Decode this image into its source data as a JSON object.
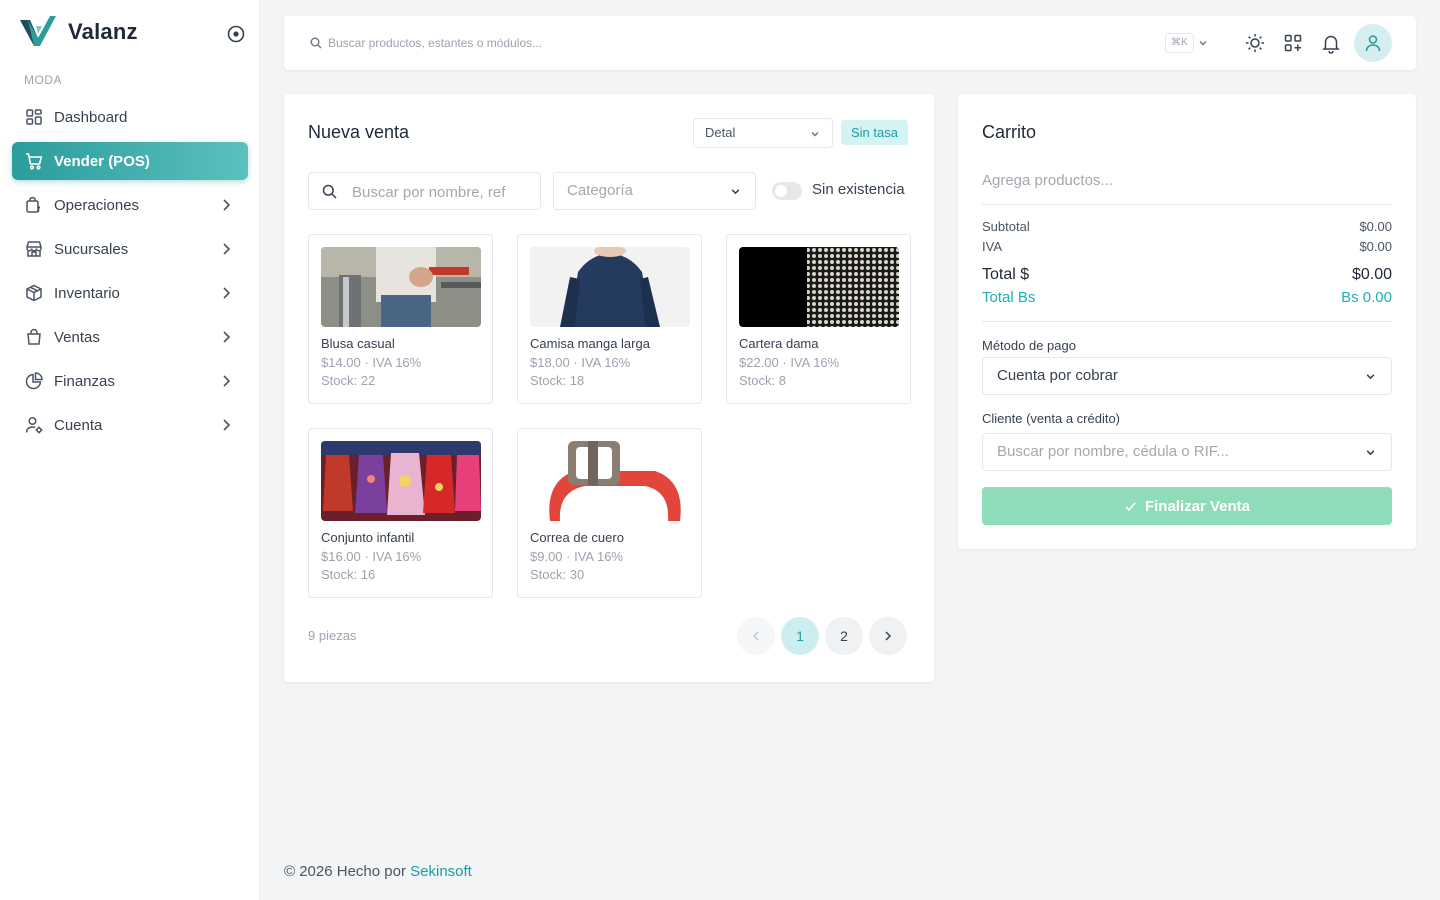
{
  "brand": {
    "name": "Valanz"
  },
  "sidebar": {
    "section": "MODA",
    "items": [
      {
        "label": "Dashboard",
        "icon": "dashboard-icon",
        "active": false,
        "has_children": false
      },
      {
        "label": "Vender (POS)",
        "icon": "cart-icon",
        "active": true,
        "has_children": false
      },
      {
        "label": "Operaciones",
        "icon": "operations-icon",
        "active": false,
        "has_children": true
      },
      {
        "label": "Sucursales",
        "icon": "store-icon",
        "active": false,
        "has_children": true
      },
      {
        "label": "Inventario",
        "icon": "box-icon",
        "active": false,
        "has_children": true
      },
      {
        "label": "Ventas",
        "icon": "shopping-bag-icon",
        "active": false,
        "has_children": true
      },
      {
        "label": "Finanzas",
        "icon": "pie-chart-icon",
        "active": false,
        "has_children": true
      },
      {
        "label": "Cuenta",
        "icon": "user-settings-icon",
        "active": false,
        "has_children": true
      }
    ]
  },
  "topbar": {
    "search_placeholder": "Buscar productos, estantes o módulos...",
    "shortcut": "⌘K"
  },
  "sale": {
    "title": "Nueva venta",
    "mode": "Detal",
    "rate_badge": "Sin tasa",
    "search_placeholder": "Buscar por nombre, ref",
    "category_placeholder": "Categoría",
    "stock_toggle_label": "Sin existencia",
    "products": [
      {
        "name": "Blusa casual",
        "price": "$14.00 · IVA 16%",
        "stock": "Stock: 22"
      },
      {
        "name": "Camisa manga larga",
        "price": "$18.00 · IVA 16%",
        "stock": "Stock: 18"
      },
      {
        "name": "Cartera dama",
        "price": "$22.00 · IVA 16%",
        "stock": "Stock: 8"
      },
      {
        "name": "Conjunto infantil",
        "price": "$16.00 · IVA 16%",
        "stock": "Stock: 16"
      },
      {
        "name": "Correa de cuero",
        "price": "$9.00 · IVA 16%",
        "stock": "Stock: 30"
      }
    ],
    "pieces": "9 piezas",
    "pagination": {
      "pages": [
        "1",
        "2"
      ],
      "current": "1"
    }
  },
  "cart": {
    "title": "Carrito",
    "empty_text": "Agrega productos...",
    "subtotal_label": "Subtotal",
    "subtotal": "$0.00",
    "iva_label": "IVA",
    "iva": "$0.00",
    "total_label": "Total $",
    "total": "$0.00",
    "total_bs_label": "Total Bs",
    "total_bs": "Bs 0.00",
    "payment_label": "Método de pago",
    "payment_value": "Cuenta por cobrar",
    "client_label": "Cliente (venta a crédito)",
    "client_placeholder": "Buscar por nombre, cédula o RIF...",
    "finish_label": "Finalizar Venta"
  },
  "footer": {
    "prefix": "© 2026 Hecho por",
    "company": "Sekinsoft"
  },
  "colors": {
    "accent": "#2a9d9c",
    "accent_light": "#5cc0be",
    "finish": "#8fdcb8"
  }
}
